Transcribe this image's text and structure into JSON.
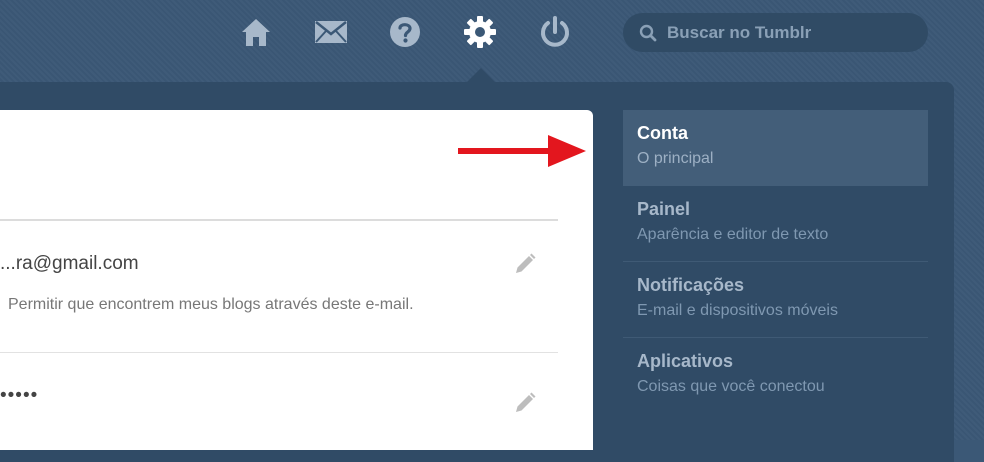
{
  "header": {
    "nav_icons": [
      "home-icon",
      "mail-icon",
      "help-icon",
      "gear-icon",
      "power-icon"
    ],
    "search": {
      "placeholder": "Buscar no Tumblr",
      "value": ""
    }
  },
  "account": {
    "email": "...ra@gmail.com",
    "email_hint": "Permitir que encontrem meus blogs através deste e-mail.",
    "password": "•••••"
  },
  "settings_menu": {
    "items": [
      {
        "title": "Conta",
        "subtitle": "O principal",
        "active": true
      },
      {
        "title": "Painel",
        "subtitle": "Aparência e editor de texto",
        "active": false
      },
      {
        "title": "Notificações",
        "subtitle": "E-mail e dispositivos móveis",
        "active": false
      },
      {
        "title": "Aplicativos",
        "subtitle": "Coisas que você conectou",
        "active": false
      }
    ]
  },
  "colors": {
    "background": "#3b5876",
    "panel": "#304b66",
    "active_item": "#435e79",
    "annotation_arrow": "#e3161e"
  }
}
